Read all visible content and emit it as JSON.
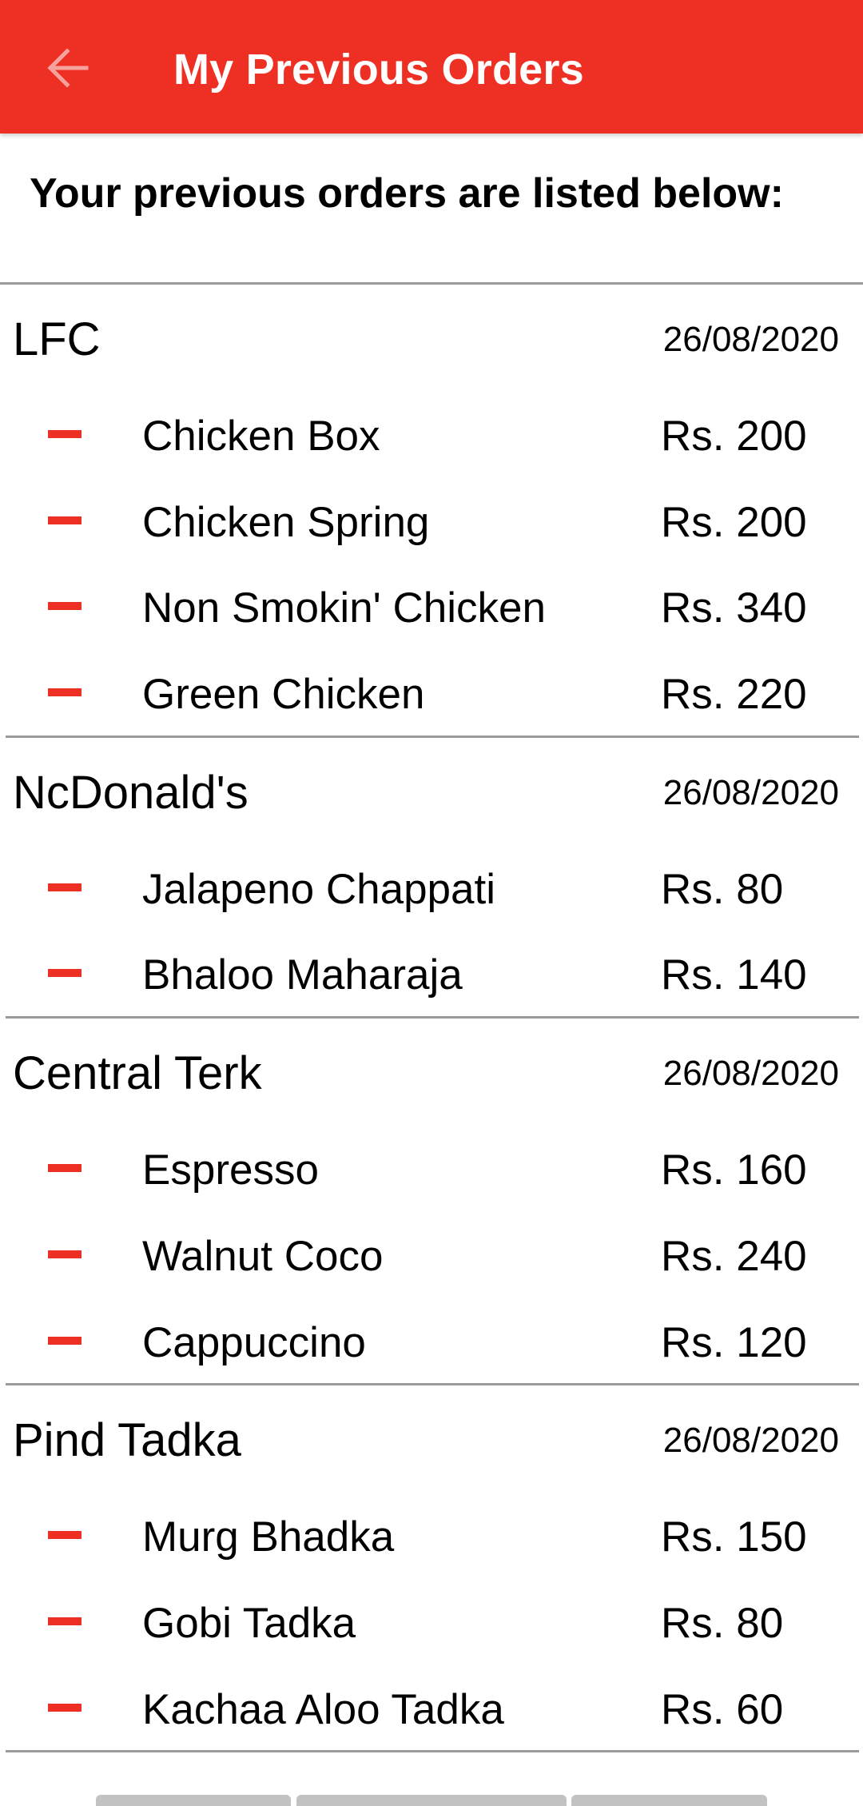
{
  "appbar": {
    "title": "My Previous Orders",
    "back_icon": "arrow-left-icon"
  },
  "subtitle": "Your previous orders are listed below:",
  "colors": {
    "accent": "#ee3024",
    "divider": "#9a9a9a"
  },
  "orders": [
    {
      "restaurant": "LFC",
      "date": "26/08/2020",
      "items": [
        {
          "name": "Chicken Box",
          "price": "Rs. 200"
        },
        {
          "name": "Chicken Spring",
          "price": "Rs. 200"
        },
        {
          "name": "Non Smokin' Chicken",
          "price": "Rs. 340"
        },
        {
          "name": "Green Chicken",
          "price": "Rs. 220"
        }
      ]
    },
    {
      "restaurant": "NcDonald's",
      "date": "26/08/2020",
      "items": [
        {
          "name": "Jalapeno Chappati",
          "price": "Rs. 80"
        },
        {
          "name": "Bhaloo Maharaja",
          "price": "Rs. 140"
        }
      ]
    },
    {
      "restaurant": "Central Terk",
      "date": "26/08/2020",
      "items": [
        {
          "name": "Espresso",
          "price": "Rs. 160"
        },
        {
          "name": "Walnut Coco",
          "price": "Rs. 240"
        },
        {
          "name": "Cappuccino",
          "price": "Rs. 120"
        }
      ]
    },
    {
      "restaurant": "Pind Tadka",
      "date": "26/08/2020",
      "items": [
        {
          "name": "Murg Bhadka",
          "price": "Rs. 150"
        },
        {
          "name": "Gobi Tadka",
          "price": "Rs. 80"
        },
        {
          "name": "Kachaa Aloo Tadka",
          "price": "Rs. 60"
        }
      ]
    }
  ]
}
